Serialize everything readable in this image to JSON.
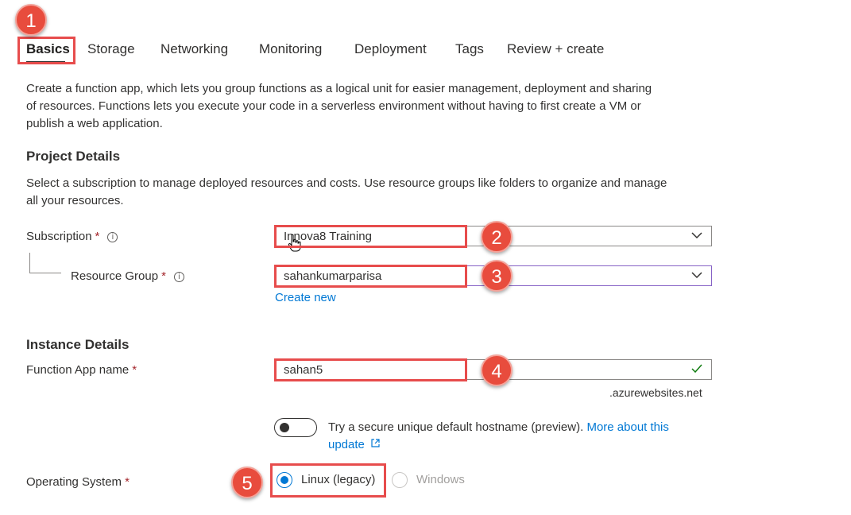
{
  "tabs": [
    {
      "label": "Basics",
      "active": true
    },
    {
      "label": "Storage"
    },
    {
      "label": "Networking"
    },
    {
      "label": "Monitoring"
    },
    {
      "label": "Deployment"
    },
    {
      "label": "Tags"
    },
    {
      "label": "Review + create"
    }
  ],
  "intro": {
    "line1": "Create a function app, which lets you group functions as a logical unit for easier management, deployment and sharing",
    "line2": "of resources. Functions lets you execute your code in a serverless environment without having to first create a VM or",
    "line3": "publish a web application."
  },
  "project": {
    "heading": "Project Details",
    "desc_line1": "Select a subscription to manage deployed resources and costs. Use resource groups like folders to organize and manage",
    "desc_line2": "all your resources.",
    "subscription_label": "Subscription",
    "subscription_value": "Innova8 Training",
    "resource_group_label": "Resource Group",
    "resource_group_value": "sahankumarparisa",
    "create_new": "Create new"
  },
  "instance": {
    "heading": "Instance Details",
    "app_name_label": "Function App name",
    "app_name_value": "sahan5",
    "suffix": ".azurewebsites.net",
    "toggle_text": "Try a secure unique default hostname (preview).",
    "toggle_link1": "More about this",
    "toggle_link2": "update",
    "os_label": "Operating System",
    "os_options": [
      {
        "label": "Linux (legacy)",
        "selected": true
      },
      {
        "label": "Windows",
        "selected": false
      }
    ]
  },
  "required_mark": "*",
  "info_glyph": "i",
  "badges": [
    "1",
    "2",
    "3",
    "4",
    "5"
  ],
  "colors": {
    "accent": "#0078d4",
    "highlight": "#e74c4c",
    "badge": "#e84c3d",
    "required": "#a4262c",
    "valid": "#107c10"
  }
}
